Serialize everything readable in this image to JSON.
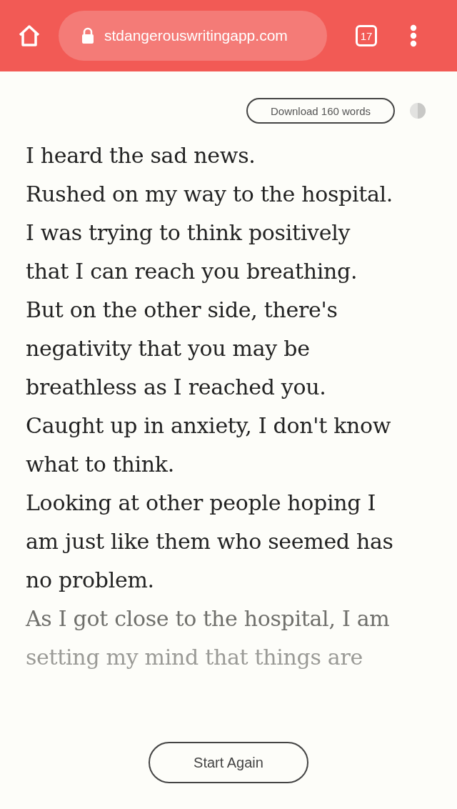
{
  "browser": {
    "url": "stdangerouswritingapp.com",
    "tab_count": "17"
  },
  "toolbar": {
    "download_label": "Download 160 words"
  },
  "text_lines": [
    "I heard the sad news.",
    "Rushed on my way to the hospital.",
    "I was trying to think positively",
    "that I can reach you breathing.",
    "But on the other side, there's",
    "negativity that you may be",
    "breathless as I reached you.",
    "Caught up in anxiety, I don't know",
    "what to think.",
    "Looking at other people hoping I",
    "am just like them who seemed has",
    "no problem.",
    "As I got close to the hospital, I am",
    "setting my mind that things are"
  ],
  "start_again_label": "Start Again"
}
